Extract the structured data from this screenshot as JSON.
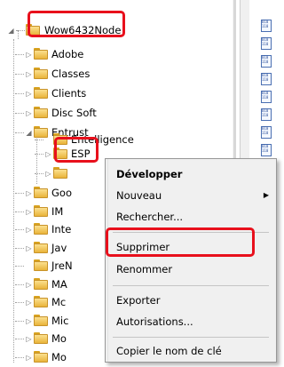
{
  "tree": {
    "root": {
      "label": "Wow6432Node",
      "expander": "◢"
    },
    "items": [
      {
        "label": "Adobe",
        "expander": "▷"
      },
      {
        "label": "Classes",
        "expander": "▷"
      },
      {
        "label": "Clients",
        "expander": "▷"
      },
      {
        "label": "Disc Soft",
        "expander": "▷"
      },
      {
        "label": "Entrust",
        "expander": "◢"
      },
      {
        "label": "Entelligence",
        "expander": ""
      },
      {
        "label": "ESP",
        "expander": "▷"
      },
      {
        "label": "",
        "expander": "▷"
      },
      {
        "label": "Goo",
        "expander": "▷"
      },
      {
        "label": "IM",
        "expander": "▷"
      },
      {
        "label": "Inte",
        "expander": "▷"
      },
      {
        "label": "Jav",
        "expander": "▷"
      },
      {
        "label": "JreN",
        "expander": ""
      },
      {
        "label": "MA",
        "expander": "▷"
      },
      {
        "label": "Mc",
        "expander": "▷"
      },
      {
        "label": "Mic",
        "expander": "▷"
      },
      {
        "label": "Mo",
        "expander": "▷"
      },
      {
        "label": "Mo",
        "expander": "▷"
      }
    ]
  },
  "context_menu": {
    "expand": "Développer",
    "new": "Nouveau",
    "new_arrow": "▶",
    "find": "Rechercher...",
    "delete": "Supprimer",
    "rename": "Renommer",
    "export": "Exporter",
    "permissions": "Autorisations...",
    "copy_key_name": "Copier le nom de clé"
  },
  "colors": {
    "highlight": "#e8101c",
    "folder": "#e9b43a",
    "menu_bg": "#f0f0f0"
  }
}
